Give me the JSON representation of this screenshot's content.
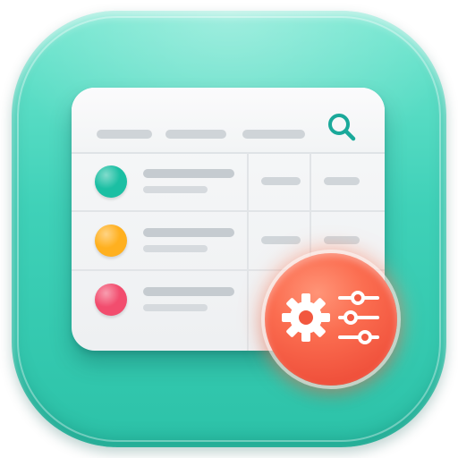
{
  "icon": {
    "background_color": "#3fd1b8",
    "glyph": "table-with-settings-icon"
  },
  "card": {
    "search_icon": "search-icon",
    "accent_color": "#1aa99a",
    "header_placeholders": 3,
    "rows": [
      {
        "status_color": "#1bbfa3"
      },
      {
        "status_color": "#ffb01f"
      },
      {
        "status_color": "#f24d6e"
      }
    ]
  },
  "badge": {
    "color": "#f45a42",
    "icons": [
      "gear-icon",
      "sliders-icon"
    ]
  }
}
